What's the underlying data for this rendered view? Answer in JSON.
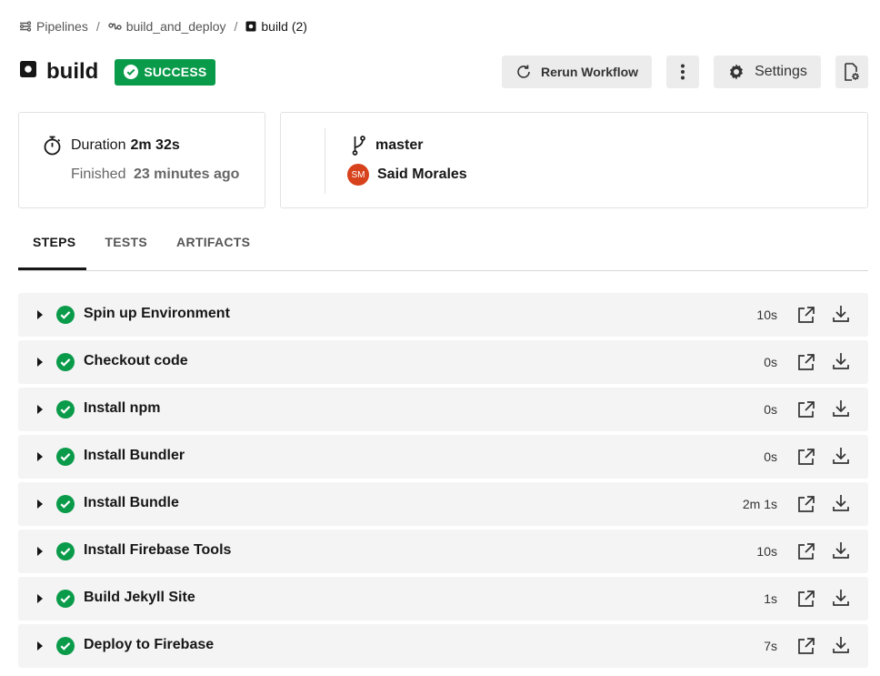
{
  "breadcrumb": {
    "pipelines": "Pipelines",
    "workflow": "build_and_deploy",
    "job": "build (2)",
    "sep": "/"
  },
  "job": {
    "title": "build",
    "status": "SUCCESS",
    "status_color": "#0a9b4a"
  },
  "actions": {
    "rerun": "Rerun Workflow",
    "settings": "Settings"
  },
  "summary": {
    "duration_label": "Duration",
    "duration_value": "2m 32s",
    "finished_label": "Finished",
    "finished_value": "23 minutes ago",
    "branch": "master",
    "author": "Said Morales",
    "author_initials": "SM",
    "avatar_color": "#d7411b"
  },
  "tabs": [
    {
      "label": "STEPS",
      "active": true
    },
    {
      "label": "TESTS",
      "active": false
    },
    {
      "label": "ARTIFACTS",
      "active": false
    }
  ],
  "steps": [
    {
      "name": "Spin up Environment",
      "duration": "10s"
    },
    {
      "name": "Checkout code",
      "duration": "0s"
    },
    {
      "name": "Install npm",
      "duration": "0s"
    },
    {
      "name": "Install Bundler",
      "duration": "0s"
    },
    {
      "name": "Install Bundle",
      "duration": "2m 1s"
    },
    {
      "name": "Install Firebase Tools",
      "duration": "10s"
    },
    {
      "name": "Build Jekyll Site",
      "duration": "1s"
    },
    {
      "name": "Deploy to Firebase",
      "duration": "7s"
    }
  ]
}
